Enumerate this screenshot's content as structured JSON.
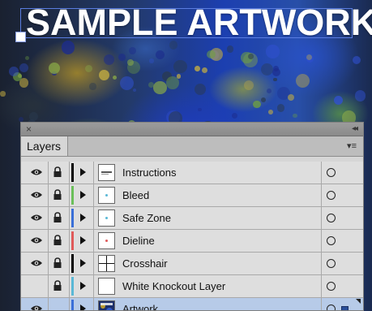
{
  "artwork": {
    "title": "SAMPLE ARTWORK"
  },
  "panel": {
    "close_glyph": "×",
    "collapse_glyph": "◂◂",
    "tab_label": "Layers",
    "menu_glyph": "▾≡"
  },
  "layers": [
    {
      "name": "Instructions",
      "visible": true,
      "locked": true,
      "color": "#000000",
      "thumb": "text",
      "selected": false
    },
    {
      "name": "Bleed",
      "visible": true,
      "locked": true,
      "color": "#6bbf5a",
      "thumb": "dot-cyan",
      "selected": false
    },
    {
      "name": "Safe Zone",
      "visible": true,
      "locked": true,
      "color": "#3a6fd8",
      "thumb": "dot-cyan",
      "selected": false
    },
    {
      "name": "Dieline",
      "visible": true,
      "locked": true,
      "color": "#e05a5a",
      "thumb": "dot-red",
      "selected": false
    },
    {
      "name": "Crosshair",
      "visible": true,
      "locked": true,
      "color": "#000000",
      "thumb": "cross",
      "selected": false
    },
    {
      "name": "White Knockout Layer",
      "visible": false,
      "locked": true,
      "color": "#5ab8d6",
      "thumb": "blank",
      "selected": false
    },
    {
      "name": "Artwork",
      "visible": true,
      "locked": false,
      "color": "#3a6fd8",
      "thumb": "art",
      "selected": true
    }
  ]
}
